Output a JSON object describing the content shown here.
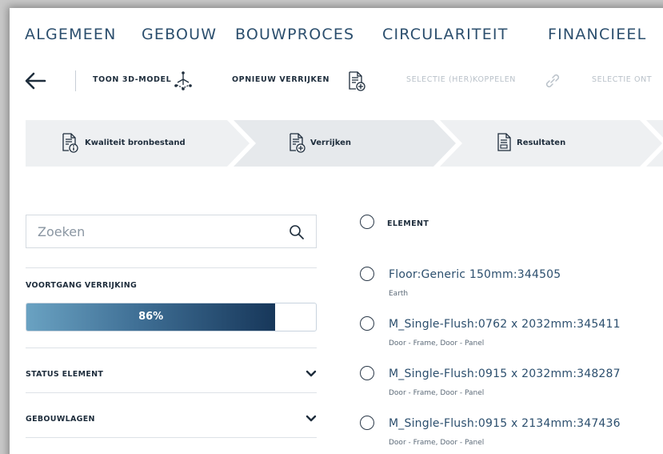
{
  "topnav": {
    "items": [
      "ALGEMEEN",
      "GEBOUW",
      "BOUWPROCES",
      "CIRCULARITEIT",
      "FINANCIEEL"
    ]
  },
  "toolbar": {
    "back_icon": "arrow-left-icon",
    "show_3d_label": "TOON 3D-MODEL",
    "reenrich_label": "OPNIEUW VERRIJKEN",
    "relink_label": "SELECTIE (HER)KOPPELEN",
    "unlink_label": "SELECTIE ONT"
  },
  "stepper": {
    "steps": [
      {
        "label": "Kwaliteit bronbestand",
        "icon": "document-info-icon"
      },
      {
        "label": "Verrijken",
        "icon": "document-add-icon"
      },
      {
        "label": "Resultaten",
        "icon": "document-results-icon"
      }
    ]
  },
  "sidebar": {
    "search_placeholder": "Zoeken",
    "progress_title": "VOORTGANG VERRIJKING",
    "progress_value": 86,
    "progress_text": "86%",
    "status_element": "STATUS ELEMENT",
    "gebouwlagen": "GEBOUWLAGEN"
  },
  "list": {
    "header": "ELEMENT",
    "items": [
      {
        "title": "Floor:Generic 150mm:344505",
        "subtitle": "Earth"
      },
      {
        "title": "M_Single-Flush:0762 x 2032mm:345411",
        "subtitle": "Door - Frame, Door - Panel"
      },
      {
        "title": "M_Single-Flush:0915 x 2032mm:348287",
        "subtitle": "Door - Frame, Door - Panel"
      },
      {
        "title": "M_Single-Flush:0915 x 2134mm:347436",
        "subtitle": "Door - Frame, Door - Panel"
      }
    ]
  },
  "colors": {
    "accent": "#2c4f6e",
    "progress_dark": "#17375a",
    "progress_light": "#6aa2c2",
    "step_bg": "#eef0f2"
  }
}
